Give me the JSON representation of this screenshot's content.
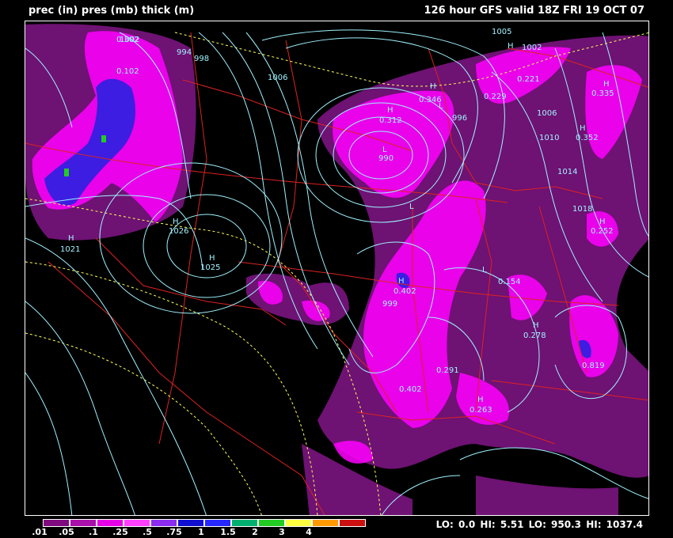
{
  "header": {
    "left": "prec (in) pres (mb) thick (m)",
    "right": "126 hour GFS valid 18Z FRI 19 OCT 07"
  },
  "colors": {
    "background": "#000000",
    "isobar": "#9ff3ff",
    "thickness": "#ffff55",
    "borders": "#dd2222",
    "precip_light": "#7a1480",
    "precip_mid": "#ff00ff",
    "precip_heavy": "#2020ff"
  },
  "legend": {
    "labels": [
      ".01",
      ".05",
      ".1",
      ".25",
      ".5",
      ".75",
      "1",
      "1.5",
      "2",
      "3",
      "4"
    ],
    "colors": [
      "#800a80",
      "#a90fa9",
      "#e600e6",
      "#ff40ff",
      "#8b2cf0",
      "#1010d0",
      "#2727ff",
      "#00b070",
      "#22cc22",
      "#ffff40",
      "#ff9900",
      "#cc1010"
    ]
  },
  "stats": {
    "text": "LO: 0.0 HI: 5.51 LO: 950.3 HI: 1037.4"
  },
  "map": {
    "labels": [
      {
        "text": "1002",
        "color": "#9ff3ff"
      },
      {
        "text": "1005",
        "color": "#9ff3ff"
      },
      {
        "text": "994",
        "color": "#9ff3ff"
      },
      {
        "text": "998",
        "color": "#9ff3ff"
      },
      {
        "text": "1006",
        "color": "#9ff3ff"
      },
      {
        "text": "1026",
        "color": "#9ff3ff"
      },
      {
        "text": "1021",
        "color": "#9ff3ff"
      },
      {
        "text": "1025",
        "color": "#9ff3ff"
      },
      {
        "text": "996",
        "color": "#9ff3ff"
      },
      {
        "text": "990",
        "color": "#9ff3ff"
      },
      {
        "text": "999",
        "color": "#9ff3ff"
      },
      {
        "text": "1002",
        "color": "#9ff3ff"
      },
      {
        "text": "1006",
        "color": "#9ff3ff"
      },
      {
        "text": "1010",
        "color": "#9ff3ff"
      },
      {
        "text": "1014",
        "color": "#9ff3ff"
      },
      {
        "text": "1018",
        "color": "#9ff3ff"
      },
      {
        "text": "0.302",
        "color": "#9ff3ff"
      },
      {
        "text": "0.102",
        "color": "#9ff3ff"
      },
      {
        "text": "0.346",
        "color": "#9ff3ff"
      },
      {
        "text": "0.312",
        "color": "#9ff3ff"
      },
      {
        "text": "0.229",
        "color": "#9ff3ff"
      },
      {
        "text": "0.221",
        "color": "#9ff3ff"
      },
      {
        "text": "0.335",
        "color": "#9ff3ff"
      },
      {
        "text": "0.352",
        "color": "#9ff3ff"
      },
      {
        "text": "0.402",
        "color": "#9ff3ff"
      },
      {
        "text": "0.291",
        "color": "#9ff3ff"
      },
      {
        "text": "0.402",
        "color": "#9ff3ff"
      },
      {
        "text": "0.154",
        "color": "#9ff3ff"
      },
      {
        "text": "0.278",
        "color": "#9ff3ff"
      },
      {
        "text": "0.819",
        "color": "#9ff3ff"
      },
      {
        "text": "0.263",
        "color": "#9ff3ff"
      },
      {
        "text": "0.252",
        "color": "#9ff3ff"
      },
      {
        "text": "H",
        "color": "#9ff3ff"
      },
      {
        "text": "H",
        "color": "#9ff3ff"
      },
      {
        "text": "H",
        "color": "#9ff3ff"
      },
      {
        "text": "H",
        "color": "#9ff3ff"
      },
      {
        "text": "H",
        "color": "#9ff3ff"
      },
      {
        "text": "H",
        "color": "#9ff3ff"
      },
      {
        "text": "H",
        "color": "#9ff3ff"
      },
      {
        "text": "H",
        "color": "#9ff3ff"
      },
      {
        "text": "H",
        "color": "#9ff3ff"
      },
      {
        "text": "H",
        "color": "#9ff3ff"
      },
      {
        "text": "H",
        "color": "#9ff3ff"
      },
      {
        "text": "H",
        "color": "#9ff3ff"
      },
      {
        "text": "L",
        "color": "#9ff3ff"
      },
      {
        "text": "L",
        "color": "#9ff3ff"
      },
      {
        "text": "L",
        "color": "#9ff3ff"
      },
      {
        "text": "L",
        "color": "#9ff3ff"
      }
    ]
  }
}
